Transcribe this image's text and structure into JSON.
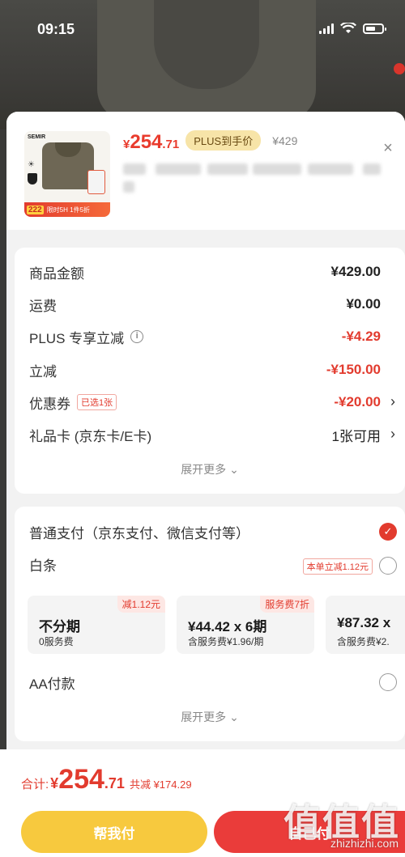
{
  "status_bar": {
    "time": "09:15"
  },
  "product": {
    "thumb_brand": "SEMIR",
    "thumb_strip_badge": "222",
    "thumb_strip_text": "限时5H 1件5折",
    "price_symbol": "¥",
    "price_int": "254",
    "price_dec": ".71",
    "plus_tag": "PLUS到手价",
    "original_price": "¥429"
  },
  "costs": {
    "rows": [
      {
        "label": "商品金额",
        "value": "¥429.00"
      },
      {
        "label": "运费",
        "value": "¥0.00"
      },
      {
        "label": "PLUS 专享立减",
        "value": "-¥4.29"
      },
      {
        "label": "立减",
        "value": "-¥150.00"
      },
      {
        "label": "优惠券",
        "tag": "已选1张",
        "value": "-¥20.00"
      },
      {
        "label": "礼品卡 (京东卡/E卡)",
        "value": "1张可用"
      }
    ],
    "more": "展开更多"
  },
  "payment": {
    "normal": "普通支付（京东支付、微信支付等）",
    "baitiao": "白条",
    "baitiao_tag": "本单立减1.12元",
    "plans": [
      {
        "tag": "减1.12元",
        "main": "不分期",
        "sub": "0服务费"
      },
      {
        "tag": "服务费7折",
        "main": "¥44.42 x 6期",
        "sub": "含服务费¥1.96/期"
      },
      {
        "tag": "",
        "main": "¥87.32 x",
        "sub": "含服务费¥2."
      }
    ],
    "aa": "AA付款",
    "more": "展开更多"
  },
  "footer": {
    "total_label": "合计:",
    "total_symbol": "¥",
    "total_int": "254",
    "total_dec": ".71",
    "total_save": "共减 ¥174.29",
    "help_button": "帮我付",
    "pay_button": "自己付"
  },
  "watermark": {
    "main": "值值值",
    "sub": "zhizhizhi.com"
  },
  "colors": {
    "accent_red": "#e23b2e",
    "help_yellow": "#f7c93e"
  }
}
